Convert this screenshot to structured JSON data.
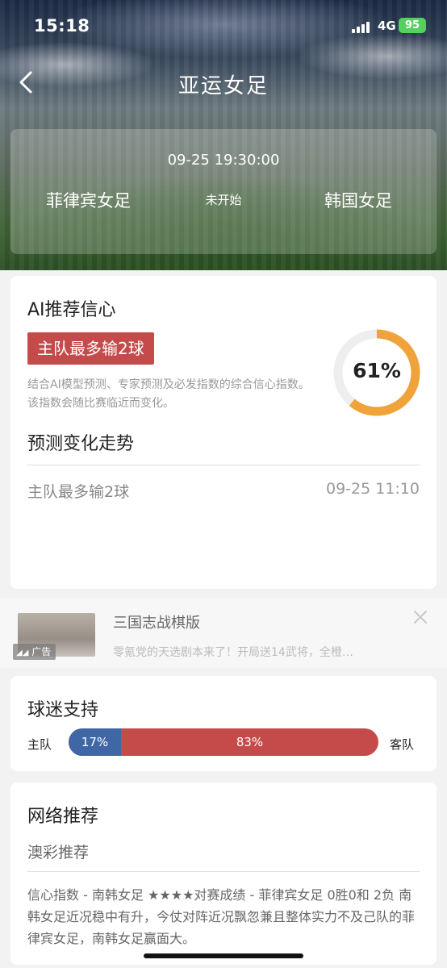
{
  "status_bar": {
    "time": "15:18",
    "network": "4G",
    "battery": "95"
  },
  "nav": {
    "title": "亚运女足",
    "back_icon": "chevron-left-icon"
  },
  "match": {
    "datetime": "09-25 19:30:00",
    "home_team": "菲律宾女足",
    "status": "未开始",
    "away_team": "韩国女足"
  },
  "ai": {
    "title": "AI推荐信心",
    "pick": "主队最多输2球",
    "description": "结合AI模型预测、专家预测及必发指数的综合信心指数。该指数会随比赛临近而变化。",
    "confidence_label": "61%",
    "confidence": 0.61,
    "trend_title": "预测变化走势",
    "trend": [
      {
        "pick": "主队最多输2球",
        "time": "09-25 11:10"
      }
    ],
    "colors": {
      "ring": "#f0a33a",
      "ring_bg": "#eeeeee",
      "badge": "#c54b4b"
    }
  },
  "ad": {
    "tag": "广告",
    "title": "三国志战棋版",
    "desc": "零氪党的天选剧本来了！开局送14武将，全橙…",
    "close_icon": "close-icon"
  },
  "fans": {
    "title": "球迷支持",
    "home_label": "主队",
    "away_label": "客队",
    "home_pct": "17%",
    "away_pct": "83%",
    "home_share": 0.17,
    "colors": {
      "home": "#3f67a6",
      "away": "#c54b4b"
    }
  },
  "network": {
    "title": "网络推荐",
    "source": "澳彩推荐",
    "text": "信心指数 - 南韩女足 ★★★★对赛成绩 - 菲律宾女足 0胜0和 2负 南韩女足近况稳中有升，今仗对阵近况飘忽兼且整体实力不及己队的菲律宾女足，南韩女足赢面大。"
  }
}
